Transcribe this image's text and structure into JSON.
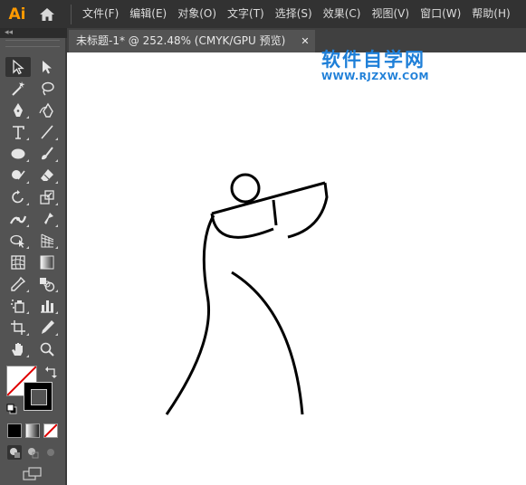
{
  "app": {
    "logo_text": "Ai",
    "menu": [
      "文件(F)",
      "编辑(E)",
      "对象(O)",
      "文字(T)",
      "选择(S)",
      "效果(C)",
      "视图(V)",
      "窗口(W)",
      "帮助(H)"
    ]
  },
  "panel": {
    "collapse_glyph": "◂◂"
  },
  "document": {
    "tab_title": "未标题-1* @ 252.48% (CMYK/GPU 预览)",
    "close_glyph": "✕"
  },
  "watermark": {
    "title": "软件自学网",
    "url": "WWW.RJZXW.COM",
    "color": "#1e7fd8"
  },
  "colors": {
    "logo": "#ff9a00",
    "menubar": "#323232",
    "toolbar": "#535353",
    "canvas": "#ffffff",
    "stroke": "#000000"
  },
  "tools": [
    "selection-tool",
    "direct-selection-tool",
    "magic-wand-tool",
    "lasso-tool",
    "pen-tool",
    "curvature-tool",
    "type-tool",
    "line-segment-tool",
    "ellipse-tool",
    "paintbrush-tool",
    "shaper-tool",
    "eraser-tool",
    "rotate-tool",
    "scale-tool",
    "width-tool",
    "puppet-warp-tool",
    "shape-builder-tool",
    "perspective-grid-tool",
    "mesh-tool",
    "gradient-tool",
    "eyedropper-tool",
    "blend-tool",
    "symbol-sprayer-tool",
    "column-graph-tool",
    "artboard-tool",
    "slice-tool",
    "hand-tool",
    "zoom-tool"
  ]
}
